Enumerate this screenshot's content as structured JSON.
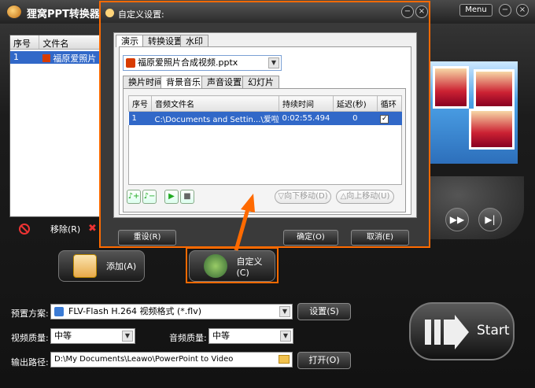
{
  "app": {
    "title": "狸窝PPT转换器",
    "menu_label": "Menu",
    "min": "−",
    "close": "×"
  },
  "filelist": {
    "headers": [
      "序号",
      "文件名"
    ],
    "rows": [
      {
        "index": "1",
        "name": "福原爱照片"
      }
    ]
  },
  "remove_label": "移除(R)",
  "buttons": {
    "add": "添加(A)",
    "custom": "自定义(C)"
  },
  "form": {
    "preset_label": "预置方案:",
    "preset_value": "FLV-Flash H.264 视频格式 (*.flv)",
    "settings_btn": "设置(S)",
    "video_quality_label": "视频质量:",
    "video_quality_value": "中等",
    "audio_quality_label": "音频质量:",
    "audio_quality_value": "中等",
    "output_label": "输出路径:",
    "output_value": "D:\\My Documents\\Leawo\\PowerPoint to Video",
    "open_btn": "打开(O)"
  },
  "start_label": "Start",
  "dialog": {
    "title": "自定义设置:",
    "tabs": [
      "演示",
      "转换设置",
      "水印"
    ],
    "file_select": "福原爱照片合成视频.pptx",
    "inner_tabs": [
      "换片时间",
      "背景音乐",
      "声音设置",
      "幻灯片"
    ],
    "table_headers": [
      "序号",
      "音频文件名",
      "持续时间",
      "延迟(秒)",
      "循环"
    ],
    "table_rows": [
      {
        "index": "1",
        "file": "C:\\Documents and Settin...\\爱啦啦.mp3",
        "duration": "0:02:55.494",
        "delay": "0",
        "loop": true
      }
    ],
    "move_down": "向下移动(D)",
    "move_up": "向上移动(U)",
    "reset": "重设(R)",
    "ok": "确定(O)",
    "cancel": "取消(E)"
  },
  "colors": {
    "accent": "#ff6a00",
    "selection": "#3168c8"
  }
}
